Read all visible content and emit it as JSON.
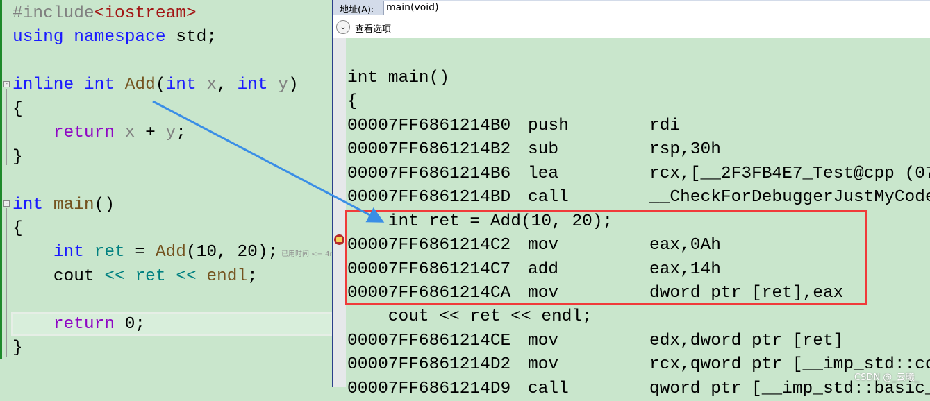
{
  "source_editor": {
    "lines": [
      [
        [
          "pp",
          "#include"
        ],
        [
          "inc",
          "<iostream>"
        ]
      ],
      [
        [
          "kw",
          "using"
        ],
        [
          "tx",
          " "
        ],
        [
          "kw",
          "namespace"
        ],
        [
          "tx",
          " std;"
        ]
      ],
      [],
      [
        [
          "kw",
          "inline"
        ],
        [
          "tx",
          " "
        ],
        [
          "kw",
          "int"
        ],
        [
          "tx",
          " "
        ],
        [
          "fn",
          "Add"
        ],
        [
          "tx",
          "("
        ],
        [
          "kw",
          "int"
        ],
        [
          "tx",
          " "
        ],
        [
          "prm",
          "x"
        ],
        [
          "tx",
          ", "
        ],
        [
          "kw",
          "int"
        ],
        [
          "tx",
          " "
        ],
        [
          "prm",
          "y"
        ],
        [
          "tx",
          ")"
        ]
      ],
      [
        [
          "tx",
          "{"
        ]
      ],
      [
        [
          "tx",
          "    "
        ],
        [
          "ctl",
          "return"
        ],
        [
          "tx",
          " "
        ],
        [
          "prm",
          "x"
        ],
        [
          "tx",
          " + "
        ],
        [
          "prm",
          "y"
        ],
        [
          "tx",
          ";"
        ]
      ],
      [
        [
          "tx",
          "}"
        ]
      ],
      [],
      [
        [
          "kw",
          "int"
        ],
        [
          "tx",
          " "
        ],
        [
          "fn",
          "main"
        ],
        [
          "tx",
          "()"
        ]
      ],
      [
        [
          "tx",
          "{"
        ]
      ],
      [
        [
          "tx",
          "    "
        ],
        [
          "kw",
          "int"
        ],
        [
          "tx",
          " "
        ],
        [
          "op",
          "ret"
        ],
        [
          "tx",
          " = "
        ],
        [
          "fn",
          "Add"
        ],
        [
          "tx",
          "(10, 20);"
        ]
      ],
      [
        [
          "tx",
          "    "
        ],
        [
          "tx",
          "cout "
        ],
        [
          "op",
          "<<"
        ],
        [
          "tx",
          " "
        ],
        [
          "op",
          "ret"
        ],
        [
          "tx",
          " "
        ],
        [
          "op",
          "<<"
        ],
        [
          "tx",
          " "
        ],
        [
          "fn",
          "endl"
        ],
        [
          "tx",
          ";"
        ]
      ],
      [],
      [
        [
          "tx",
          "    "
        ],
        [
          "ctl",
          "return"
        ],
        [
          "tx",
          " 0;"
        ]
      ],
      [
        [
          "tx",
          "}"
        ]
      ]
    ],
    "elapsed_hint": "已用时间 <= 4ms"
  },
  "disassembly": {
    "address_label": "地址(A):",
    "address_value": "main(void)",
    "view_options_label": "查看选项",
    "lines": [
      {
        "src": "int main()"
      },
      {
        "src": "{"
      },
      {
        "addr": "00007FF6861214B0",
        "op": "push",
        "arg": "rdi"
      },
      {
        "addr": "00007FF6861214B2",
        "op": "sub",
        "arg": "rsp,30h"
      },
      {
        "addr": "00007FF6861214B6",
        "op": "lea",
        "arg": "rcx,[__2F3FB4E7_Test@cpp (07"
      },
      {
        "addr": "00007FF6861214BD",
        "op": "call",
        "arg": "__CheckForDebuggerJustMyCode"
      },
      {
        "src": "    int ret = Add(10, 20);"
      },
      {
        "addr": "00007FF6861214C2",
        "op": "mov",
        "arg": "eax,0Ah"
      },
      {
        "addr": "00007FF6861214C7",
        "op": "add",
        "arg": "eax,14h"
      },
      {
        "addr": "00007FF6861214CA",
        "op": "mov",
        "arg": "dword ptr [ret],eax"
      },
      {
        "src": "    cout << ret << endl;"
      },
      {
        "addr": "00007FF6861214CE",
        "op": "mov",
        "arg": "edx,dword ptr [ret]"
      },
      {
        "addr": "00007FF6861214D2",
        "op": "mov",
        "arg": "rcx,qword ptr [__imp_std::co"
      },
      {
        "addr": "00007FF6861214D9",
        "op": "call",
        "arg": "qword ptr [__imp_std::basic_"
      }
    ]
  },
  "watermark": "CSDN @_云曦_",
  "colors": {
    "highlight_box": "#f03a3a",
    "arrow": "#3a8ee6",
    "background": "#c9e6cc"
  }
}
